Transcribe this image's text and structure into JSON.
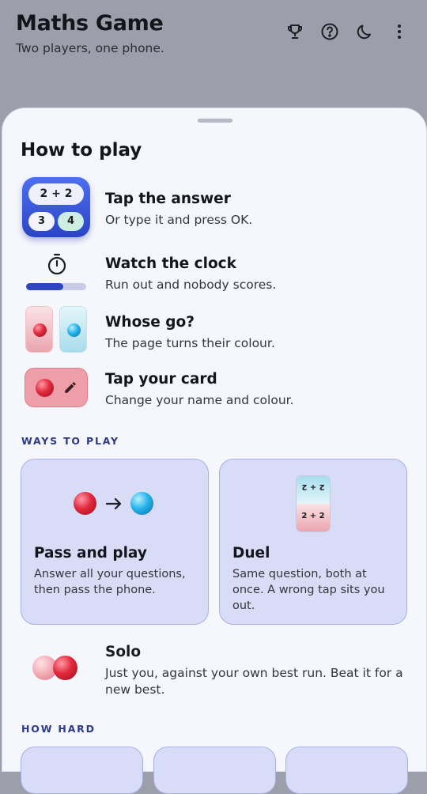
{
  "header": {
    "title": "Maths Game",
    "subtitle": "Two players, one phone.",
    "actions": [
      "trophy-icon",
      "help-icon",
      "dark-mode-icon",
      "more-icon"
    ]
  },
  "sheet": {
    "title": "How to play",
    "rules": [
      {
        "title": "Tap the answer",
        "desc": "Or type it and press OK.",
        "icon": "keypad-icon",
        "sum": "2 + 2",
        "options": [
          "3",
          "4"
        ]
      },
      {
        "title": "Watch the clock",
        "desc": "Run out and nobody scores.",
        "icon": "stopwatch-icon",
        "timer_fill": 0.62
      },
      {
        "title": "Whose go?",
        "desc": "The page turns their colour.",
        "icon": "turn-colour-icon"
      },
      {
        "title": "Tap your card",
        "desc": "Change your name and colour.",
        "icon": "edit-card-icon"
      }
    ],
    "ways_label": "WAYS TO PLAY",
    "modes": [
      {
        "title": "Pass and play",
        "desc": "Answer all your questions, then pass the phone.",
        "icon": "pass-arrow-icon"
      },
      {
        "title": "Duel",
        "desc": "Same question, both at once. A wrong tap sits you out.",
        "icon": "split-phone-icon",
        "sum_top": "2 + 2",
        "sum_bottom": "2 + 2"
      },
      {
        "title": "Solo",
        "desc": "Just you, against your own best run. Beat it for a new best.",
        "icon": "solo-balls-icon"
      }
    ],
    "difficulty_label": "HOW HARD"
  },
  "colors": {
    "backdrop": "#9c9eaa",
    "sheet": "#f6f7fd",
    "card": "#d9dcf7",
    "accent": "#2c3a86",
    "player_red": "#e2283c",
    "player_blue": "#25b4ea"
  }
}
